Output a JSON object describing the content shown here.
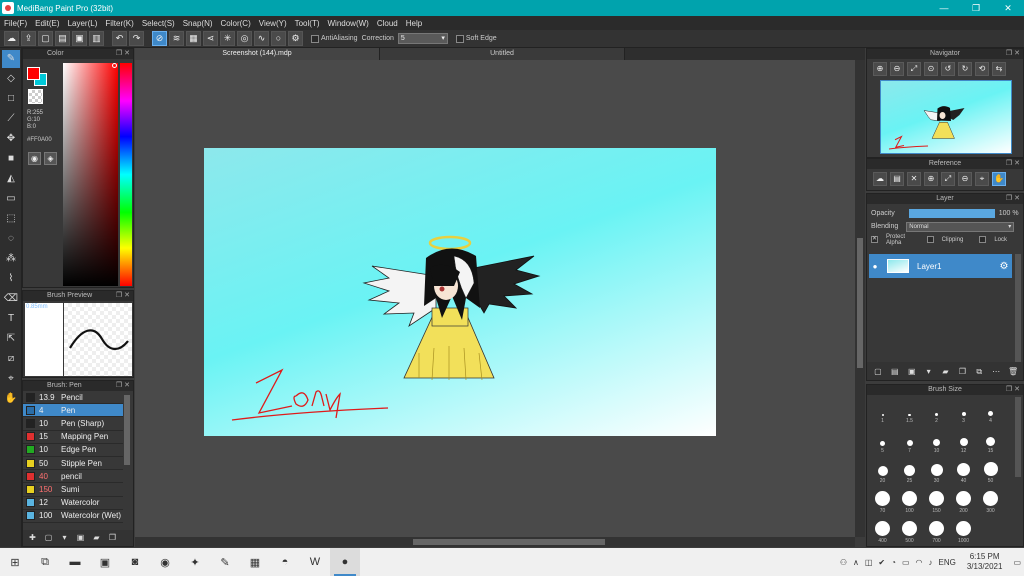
{
  "window": {
    "title": "MediBang Paint Pro (32bit)",
    "minimize": "—",
    "restore": "❐",
    "close": "✕"
  },
  "menu": [
    "File(F)",
    "Edit(E)",
    "Layer(L)",
    "Filter(K)",
    "Select(S)",
    "Snap(N)",
    "Color(C)",
    "View(Y)",
    "Tool(T)",
    "Window(W)",
    "Cloud",
    "Help"
  ],
  "toolbar": {
    "antialiasing_label": "AntiAliasing",
    "correction_label": "Correction",
    "correction_value": "5",
    "soft_edge_label": "Soft Edge"
  },
  "color_panel": {
    "title": "Color",
    "rgb_r": "R:255",
    "rgb_g": "G:10",
    "rgb_b": "B:0",
    "hex": "#FF0A00",
    "foreground": "#ff0000",
    "background": "#00c8d8"
  },
  "brush_preview": {
    "title": "Brush Preview",
    "size": "0.85mm"
  },
  "brush_list": {
    "title": "Brush: Pen",
    "items": [
      {
        "size": "13.9",
        "name": "Pencil",
        "color": "#222222",
        "selected": false
      },
      {
        "size": "4",
        "name": "Pen",
        "color": "#2b6ea8",
        "selected": true
      },
      {
        "size": "10",
        "name": "Pen (Sharp)",
        "color": "#222222",
        "selected": false
      },
      {
        "size": "15",
        "name": "Mapping Pen",
        "color": "#e03030",
        "selected": false
      },
      {
        "size": "10",
        "name": "Edge Pen",
        "color": "#22aa22",
        "selected": false
      },
      {
        "size": "50",
        "name": "Stipple Pen",
        "color": "#e8d020",
        "selected": false
      },
      {
        "size": "40",
        "name": "pencil",
        "color": "#e03030",
        "selected": false
      },
      {
        "size": "150",
        "name": "Sumi",
        "color": "#e8d020",
        "selected": false
      },
      {
        "size": "12",
        "name": "Watercolor",
        "color": "#5ab4e0",
        "selected": false
      },
      {
        "size": "100",
        "name": "Watercolor (Wet)",
        "color": "#5ab4e0",
        "selected": false
      }
    ]
  },
  "documents": {
    "tab1": "Screenshot (144).mdp",
    "tab2": "Untitled"
  },
  "canvas": {
    "signature": "Zoey"
  },
  "navigator": {
    "title": "Navigator"
  },
  "reference": {
    "title": "Reference"
  },
  "layer": {
    "title": "Layer",
    "opacity_label": "Opacity",
    "opacity_value": "100 %",
    "blending_label": "Blending",
    "blending_value": "Normal",
    "protect_alpha": "Protect Alpha",
    "clipping": "Clipping",
    "lock": "Lock",
    "layer_name": "Layer1"
  },
  "brush_size": {
    "title": "Brush Size",
    "rows": [
      [
        "1",
        "1.5",
        "2",
        "3",
        "4"
      ],
      [
        "5",
        "7",
        "10",
        "12",
        "15"
      ],
      [
        "20",
        "25",
        "30",
        "40",
        "50"
      ],
      [
        "70",
        "100",
        "150",
        "200",
        "300"
      ],
      [
        "400",
        "500",
        "700",
        "1000"
      ]
    ]
  },
  "taskbar": {
    "language": "ENG",
    "time": "6:15 PM",
    "date": "3/13/2021"
  }
}
